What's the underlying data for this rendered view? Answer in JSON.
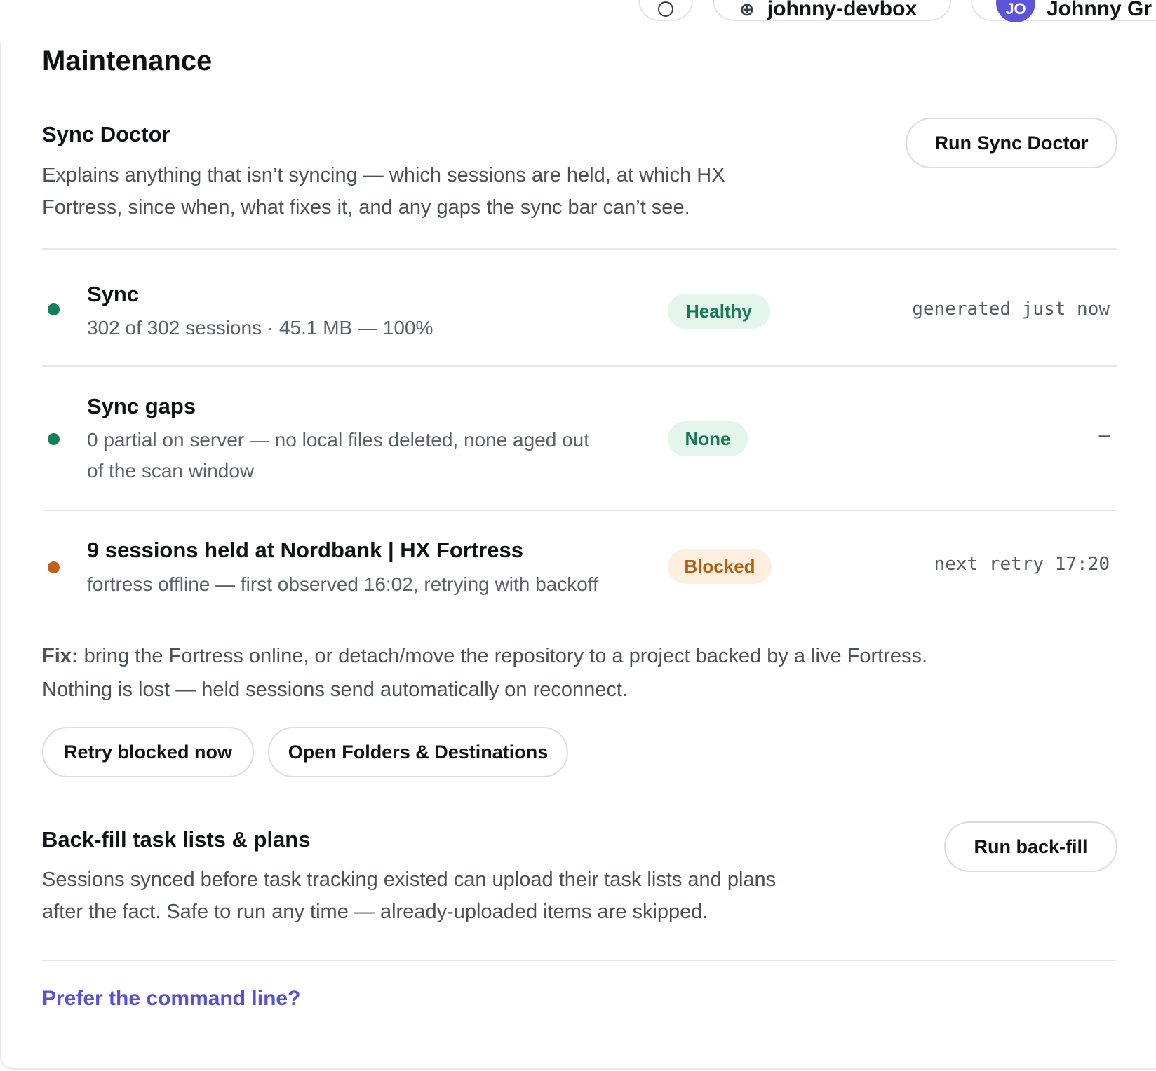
{
  "header": {
    "device_label": "johnny-devbox",
    "user_initials": "JO",
    "user_label": "Johnny Gr"
  },
  "page": {
    "title": "Maintenance"
  },
  "sync_doctor": {
    "title": "Sync Doctor",
    "description_line1": "Explains anything that isn’t syncing — which sessions are held, at which HX",
    "description_line2": "Fortress, since when, what fixes it, and any gaps the sync bar can’t see.",
    "run_button": "Run Sync Doctor"
  },
  "rows": [
    {
      "title": "Sync",
      "subtitle_line1": "302 of 302 sessions · 45.1 MB — 100%",
      "subtitle_line2": "",
      "status": "Healthy",
      "status_color": "#147a52",
      "meta": "generated just now"
    },
    {
      "title": "Sync gaps",
      "subtitle_line1": "0 partial on server — no local files deleted, none aged out",
      "subtitle_line2": "of the scan window",
      "status": "None",
      "status_color": "#147a52",
      "meta": "—"
    },
    {
      "title": "9 sessions held at Nordbank | HX Fortress",
      "subtitle_line1": "fortress offline — first observed 16:02, retrying with backoff",
      "subtitle_line2": "",
      "status": "Blocked",
      "status_color": "#b45e0e",
      "meta": "next retry 17:20"
    }
  ],
  "fix": {
    "label": "Fix:",
    "line1": " bring the Fortress online, or detach/move the repository to a project backed by a live Fortress.",
    "line2": "Nothing is lost — held sessions send automatically on reconnect.",
    "retry_button": "Retry blocked now",
    "open_button": "Open Folders & Destinations"
  },
  "backfill": {
    "title": "Back-fill task lists & plans",
    "description_line1": "Sessions synced before task tracking existed can upload their task lists and plans",
    "description_line2": "after the fact. Safe to run any time — already-uploaded items are skipped.",
    "run_button": "Run back-fill"
  },
  "cli_link": "Prefer the command line?",
  "colors": {
    "accent": "#5651d6",
    "healthy_dot": "#13805a",
    "blocked_dot": "#c0601a",
    "avatar_bg": "#5b55dc"
  }
}
